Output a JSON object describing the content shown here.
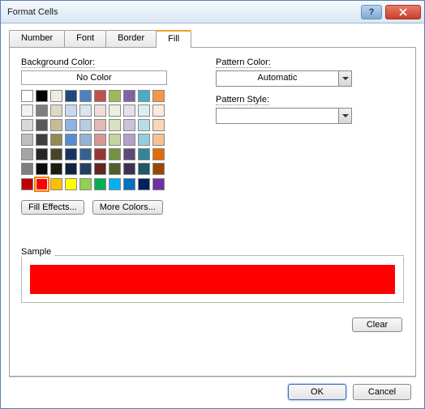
{
  "window": {
    "title": "Format Cells"
  },
  "tabs": {
    "number": "Number",
    "font": "Font",
    "border": "Border",
    "fill": "Fill",
    "active": "fill"
  },
  "fill": {
    "bg_label": "Background Color:",
    "no_color": "No Color",
    "effects_btn": "Fill Effects...",
    "more_colors_btn": "More Colors...",
    "pattern_color_label": "Pattern Color:",
    "pattern_color_value": "Automatic",
    "pattern_style_label": "Pattern Style:",
    "pattern_style_value": "",
    "selected_color": "#ff0000",
    "palette_main": [
      "#ffffff",
      "#000000",
      "#eeece1",
      "#1f497d",
      "#4f81bd",
      "#c0504d",
      "#9bbb59",
      "#8064a2",
      "#4bacc6",
      "#f79646",
      "#f2f2f2",
      "#7f7f7f",
      "#ddd9c3",
      "#c6d9f0",
      "#dbe5f1",
      "#f2dcdb",
      "#ebf1dd",
      "#e5e0ec",
      "#dbeef3",
      "#fdeada",
      "#d8d8d8",
      "#595959",
      "#c4bd97",
      "#8db3e2",
      "#b8cce4",
      "#e5b9b7",
      "#d7e3bc",
      "#ccc1d9",
      "#b7dde8",
      "#fbd5b5",
      "#bfbfbf",
      "#3f3f3f",
      "#938953",
      "#548dd4",
      "#95b3d7",
      "#d99694",
      "#c3d69b",
      "#b2a2c7",
      "#92cddc",
      "#fac08f",
      "#a5a5a5",
      "#262626",
      "#494429",
      "#17365d",
      "#366092",
      "#953734",
      "#76923c",
      "#5f497a",
      "#31859b",
      "#e36c09",
      "#7f7f7f",
      "#0c0c0c",
      "#1d1b10",
      "#0f243e",
      "#244061",
      "#632423",
      "#4f6128",
      "#3f3151",
      "#205867",
      "#974806"
    ],
    "palette_standard": [
      "#c00000",
      "#ff0000",
      "#ffc000",
      "#ffff00",
      "#92d050",
      "#00b050",
      "#00b0f0",
      "#0070c0",
      "#002060",
      "#7030a0"
    ]
  },
  "sample": {
    "label": "Sample",
    "color": "#ff0000"
  },
  "buttons": {
    "clear": "Clear",
    "ok": "OK",
    "cancel": "Cancel"
  }
}
